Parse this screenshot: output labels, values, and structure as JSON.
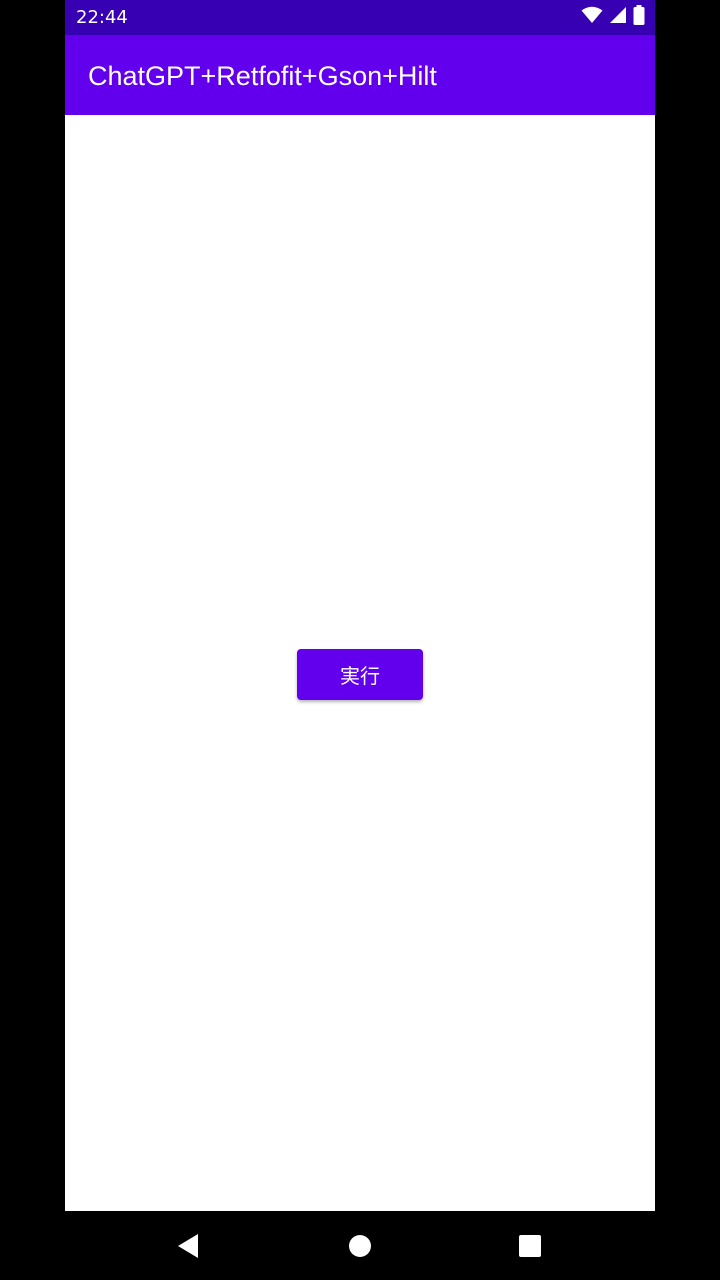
{
  "status_bar": {
    "time": "22:44",
    "icons": [
      "wifi-icon",
      "signal-icon",
      "battery-icon"
    ],
    "background": "#3700b3"
  },
  "app_bar": {
    "title": "ChatGPT+Retfofit+Gson+Hilt",
    "background": "#6200ee"
  },
  "main": {
    "run_button_label": "実行",
    "button_color": "#6200ee"
  },
  "nav_bar": {
    "icons": [
      "back-icon",
      "home-icon",
      "recents-icon"
    ]
  }
}
